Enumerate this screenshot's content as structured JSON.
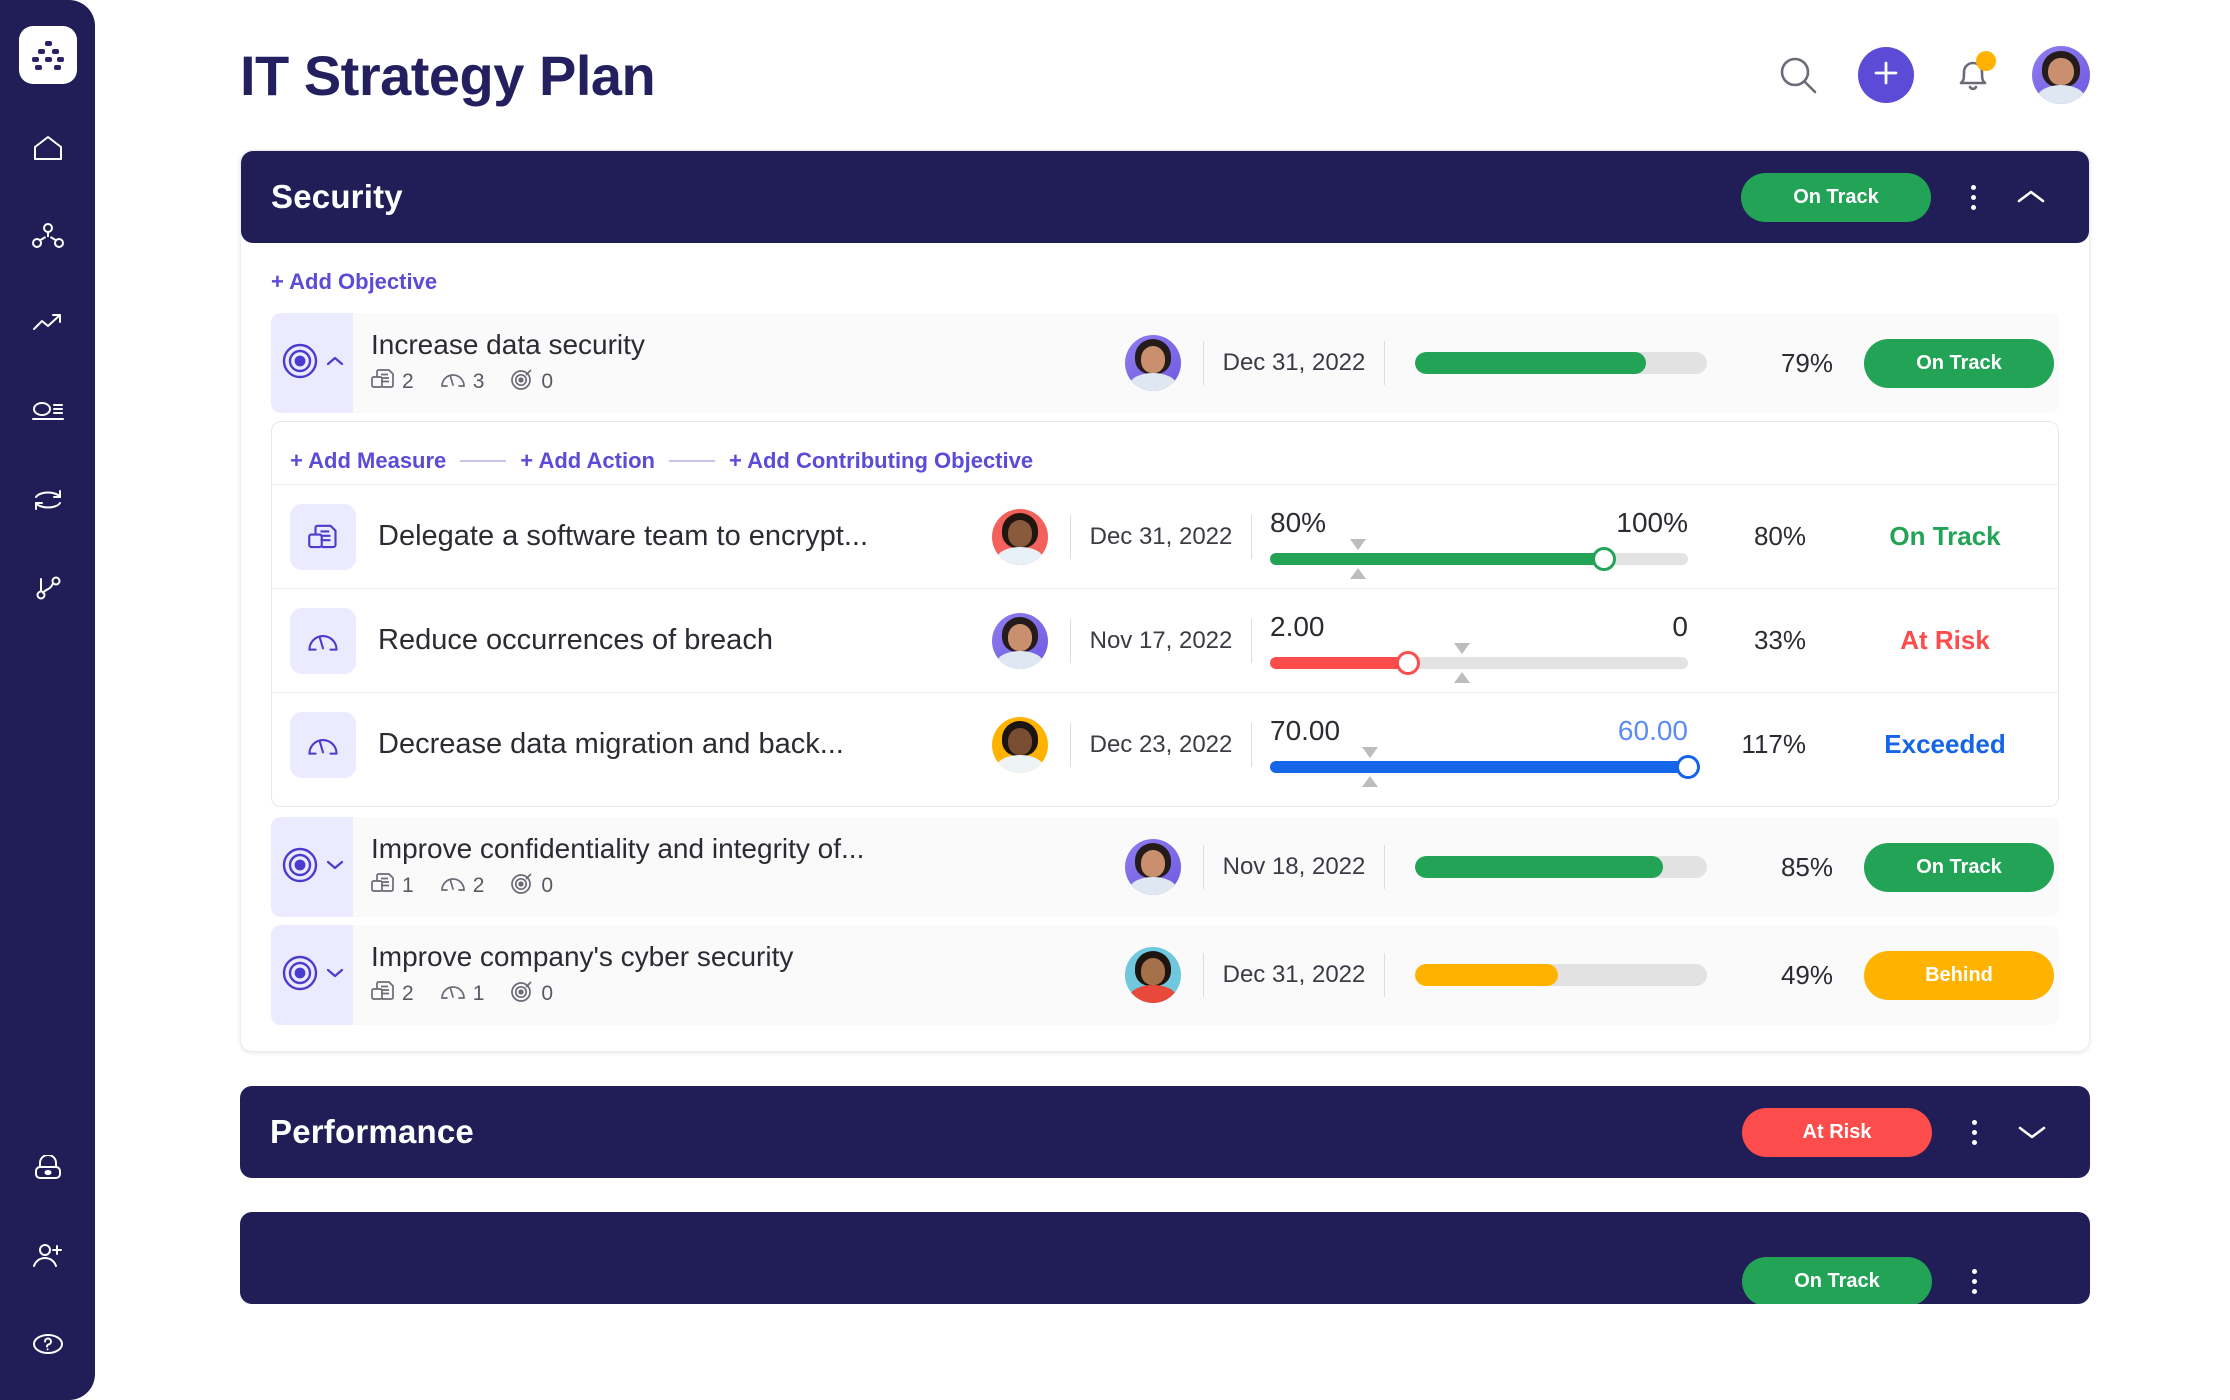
{
  "header": {
    "title": "IT Strategy Plan",
    "icons": {
      "search": "search-icon",
      "add": "plus-icon",
      "notifications": "bell-icon",
      "avatar": "user-avatar"
    }
  },
  "sidebar": {
    "logo": "app-logo-icon",
    "items": [
      {
        "icon": "home-icon",
        "name": "home"
      },
      {
        "icon": "org-chart-icon",
        "name": "org-chart"
      },
      {
        "icon": "trending-up-icon",
        "name": "analytics"
      },
      {
        "icon": "list-view-icon",
        "name": "reports"
      },
      {
        "icon": "sync-icon",
        "name": "sync"
      },
      {
        "icon": "branch-icon",
        "name": "workflows"
      }
    ],
    "bottom_items": [
      {
        "icon": "lock-icon",
        "name": "security"
      },
      {
        "icon": "add-user-icon",
        "name": "invite-user"
      },
      {
        "icon": "help-icon",
        "name": "help"
      }
    ]
  },
  "labels": {
    "add_objective": "+ Add Objective",
    "add_measure": "+ Add Measure",
    "add_action": "+ Add Action",
    "add_contributing_objective": "+ Add Contributing Objective"
  },
  "colors": {
    "brand": "#5b4bd6",
    "navy": "#211d56",
    "on_track": "#22a355",
    "at_risk": "#fc4c4c",
    "behind": "#ffb300",
    "exceeded": "#1565e8"
  },
  "sections": [
    {
      "title": "Security",
      "status": "On Track",
      "status_kind": "ontrack",
      "expanded": true,
      "chevron": "chevron-up-icon"
    },
    {
      "title": "Performance",
      "status": "At Risk",
      "status_kind": "atrisk",
      "expanded": false,
      "chevron": "chevron-down-icon"
    }
  ],
  "objectives": [
    {
      "name": "Increase data security",
      "expanded": true,
      "chevron": "chevron-up-icon",
      "counts": {
        "actions": "2",
        "measures": "3",
        "objectives": "0"
      },
      "owner": "owner-avatar-1",
      "date": "Dec 31, 2022",
      "progress": 79,
      "percent": "79%",
      "status": "On Track",
      "status_kind": "ontrack"
    },
    {
      "name": "Improve confidentiality and integrity of...",
      "expanded": false,
      "chevron": "chevron-down-icon",
      "counts": {
        "actions": "1",
        "measures": "2",
        "objectives": "0"
      },
      "owner": "owner-avatar-1",
      "date": "Nov 18, 2022",
      "progress": 85,
      "percent": "85%",
      "status": "On Track",
      "status_kind": "ontrack"
    },
    {
      "name": "Improve company's cyber security",
      "expanded": false,
      "chevron": "chevron-down-icon",
      "counts": {
        "actions": "2",
        "measures": "1",
        "objectives": "0"
      },
      "owner": "owner-avatar-4",
      "date": "Dec 31, 2022",
      "progress": 49,
      "percent": "49%",
      "status": "Behind",
      "status_kind": "behind"
    }
  ],
  "measures": [
    {
      "name": "Delegate a software team to encrypt...",
      "icon": "action-document-icon",
      "owner": "owner-avatar-2",
      "date": "Dec 31, 2022",
      "start_value": "80%",
      "target_value": "100%",
      "target_is_blue": false,
      "fill_percent": 80,
      "marker_percent": 21,
      "percent": "80%",
      "status": "On Track",
      "status_kind": "ontrack",
      "bar_color": "#22a355"
    },
    {
      "name": "Reduce occurrences of breach",
      "icon": "measure-gauge-icon",
      "owner": "owner-avatar-1",
      "date": "Nov 17, 2022",
      "start_value": "2.00",
      "target_value": "0",
      "target_is_blue": false,
      "fill_percent": 33,
      "marker_percent": 46,
      "percent": "33%",
      "status": "At Risk",
      "status_kind": "atrisk",
      "bar_color": "#fc4c4c"
    },
    {
      "name": "Decrease data migration and back...",
      "icon": "measure-gauge-icon",
      "owner": "owner-avatar-3",
      "date": "Dec 23, 2022",
      "start_value": "70.00",
      "target_value": "60.00",
      "target_is_blue": true,
      "fill_percent": 100,
      "marker_percent": 24,
      "percent": "117%",
      "status": "Exceeded",
      "status_kind": "exceeded",
      "bar_color": "#1565e8"
    }
  ],
  "next_section_peek": {
    "status": "On Track",
    "status_kind": "ontrack"
  }
}
